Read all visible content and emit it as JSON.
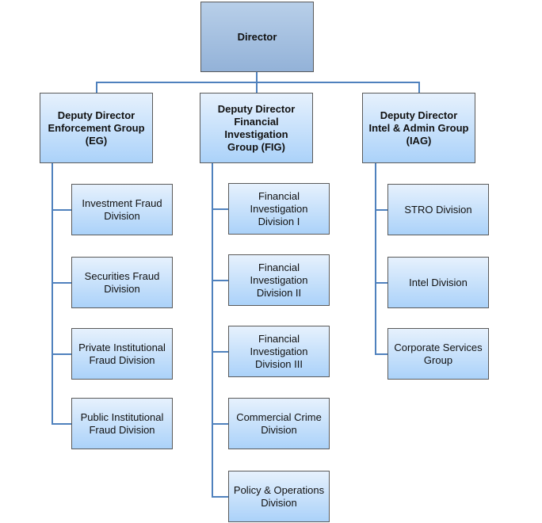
{
  "director": {
    "label": "Director"
  },
  "groups": [
    {
      "label": "Deputy Director\nEnforcement Group\n(EG)",
      "divisions": [
        "Investment Fraud\nDivision",
        "Securities Fraud\nDivision",
        "Private Institutional\nFraud Division",
        "Public Institutional\nFraud Division"
      ]
    },
    {
      "label": "Deputy Director\nFinancial Investigation\nGroup (FIG)",
      "divisions": [
        "Financial\nInvestigation\nDivision I",
        "Financial\nInvestigation\nDivision II",
        "Financial\nInvestigation\nDivision III",
        "Commercial Crime\nDivision",
        "Policy & Operations\nDivision"
      ]
    },
    {
      "label": "Deputy Director\nIntel & Admin Group\n(IAG)",
      "divisions": [
        "STRO Division",
        "Intel Division",
        "Corporate Services\nGroup"
      ]
    }
  ],
  "colors": {
    "connector": "#4f81bd",
    "director_fill": "#95b3d7",
    "box_fill": "#abd2f9"
  }
}
